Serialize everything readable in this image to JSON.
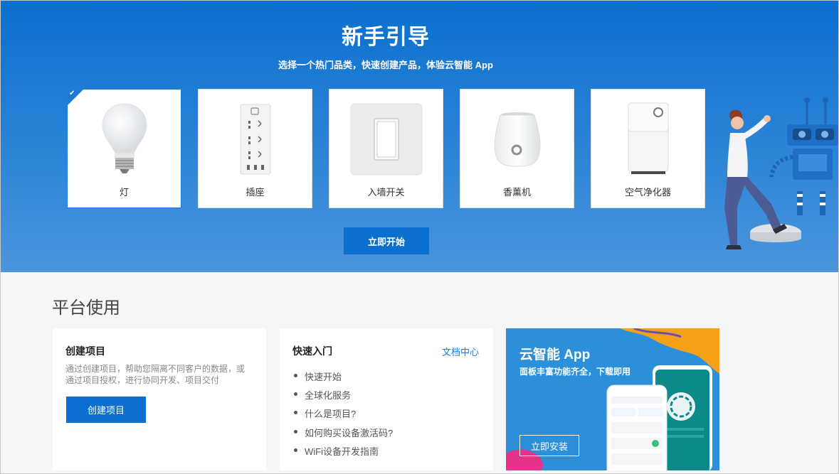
{
  "hero": {
    "title": "新手引导",
    "subtitle": "选择一个热门品类，快速创建产品，体验云智能 App",
    "start_label": "立即开始",
    "categories": [
      {
        "label": "灯",
        "icon": "bulb-icon",
        "selected": true
      },
      {
        "label": "插座",
        "icon": "socket-icon",
        "selected": false
      },
      {
        "label": "入墙开关",
        "icon": "wall-switch-icon",
        "selected": false
      },
      {
        "label": "香薰机",
        "icon": "aroma-diffuser-icon",
        "selected": false
      },
      {
        "label": "空气净化器",
        "icon": "air-purifier-icon",
        "selected": false
      }
    ]
  },
  "platform": {
    "title": "平台使用",
    "create_project": {
      "title": "创建项目",
      "description": "通过创建项目，帮助您隔离不同客户的数据，或通过项目授权，进行协同开发、项目交付",
      "button_label": "创建项目"
    },
    "quick_start": {
      "title": "快速入门",
      "doc_link": "文档中心",
      "items": [
        "快速开始",
        "全球化服务",
        "什么是项目?",
        "如何购买设备激活码?",
        "WiFi设备开发指南"
      ]
    },
    "app_promo": {
      "title": "云智能 App",
      "subtitle": "面板丰富功能齐全，下载即用",
      "button_label": "立即安装"
    }
  },
  "colors": {
    "primary": "#0a6fce",
    "hero_start": "#0a6fce",
    "hero_end": "#4a95dc",
    "promo_bg": "#2b8fd9",
    "promo_orange": "#f6a01a",
    "promo_pink": "#e6338a"
  }
}
